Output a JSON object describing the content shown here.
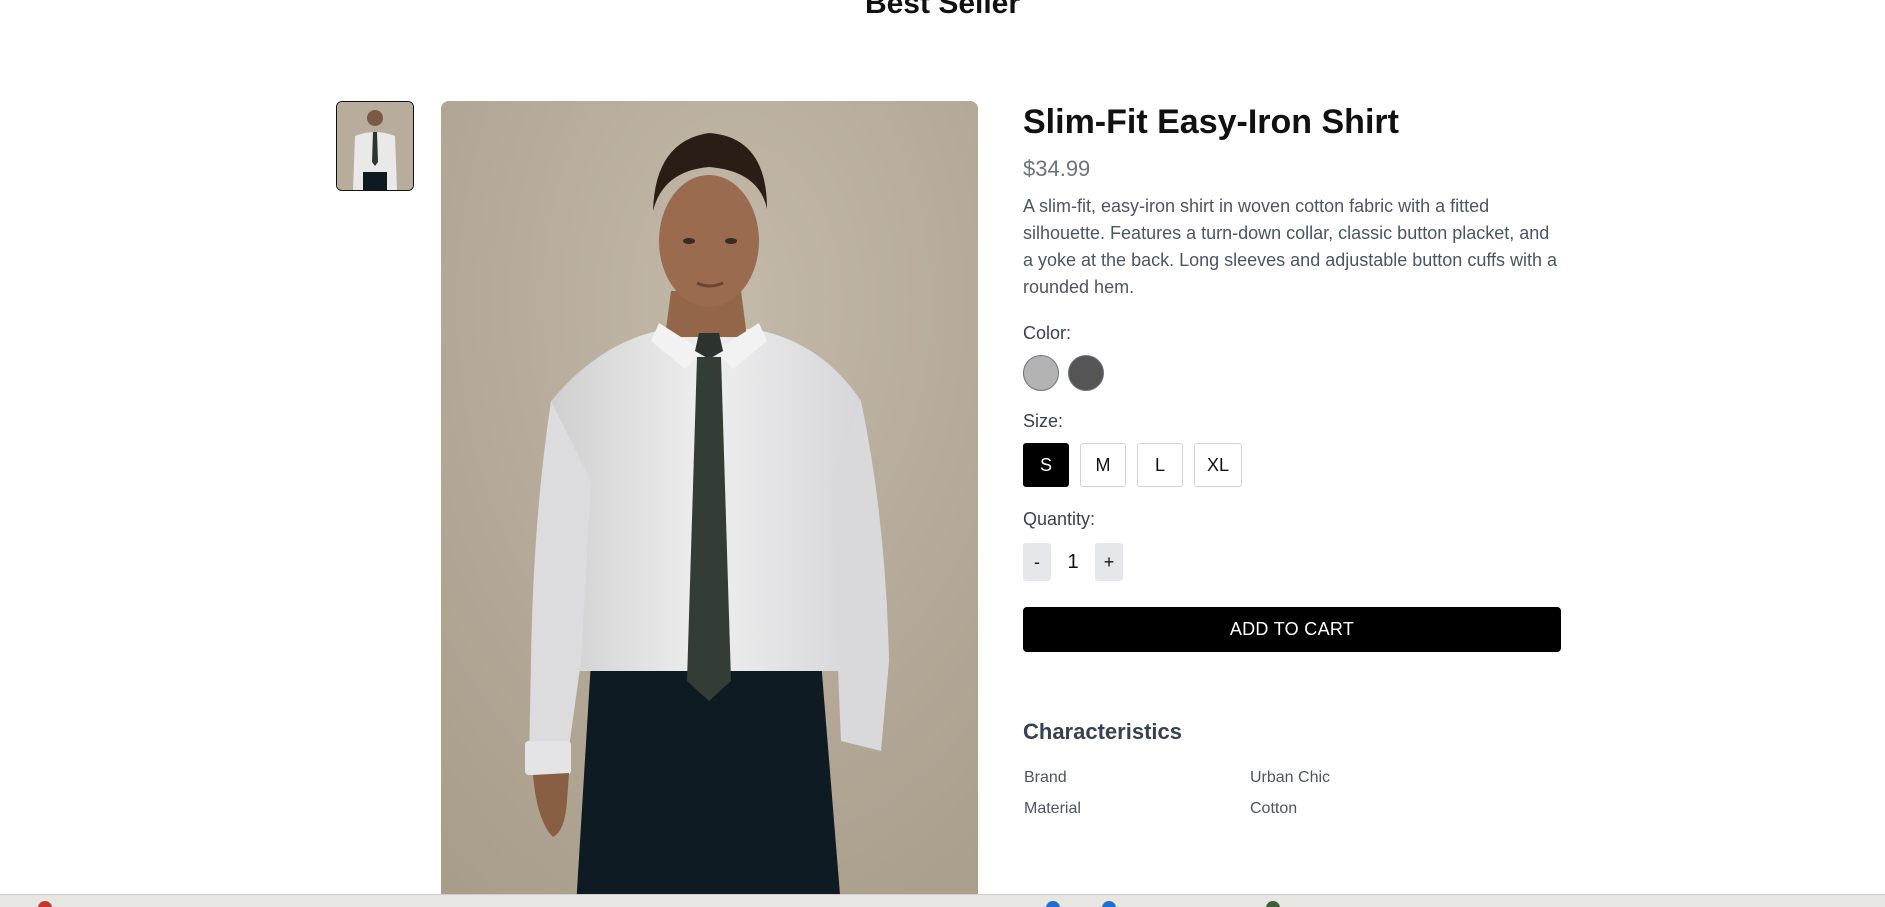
{
  "section": {
    "title": "Best Seller"
  },
  "product": {
    "title": "Slim-Fit Easy-Iron Shirt",
    "price": "$34.99",
    "description": "A slim-fit, easy-iron shirt in woven cotton fabric with a fitted silhouette. Features a turn-down collar, classic button placket, and a yoke at the back. Long sleeves and adjustable button cuffs with a rounded hem.",
    "images": {
      "main_alt": "Model wearing white shirt with dark tie",
      "thumbnail_alt": "Shirt thumbnail"
    }
  },
  "color": {
    "label": "Color:",
    "options": [
      {
        "name": "light-gray",
        "hex": "#b3b3b3"
      },
      {
        "name": "dark-gray",
        "hex": "#555555"
      }
    ]
  },
  "size": {
    "label": "Size:",
    "options": [
      "S",
      "M",
      "L",
      "XL"
    ],
    "selected": "S"
  },
  "quantity": {
    "label": "Quantity:",
    "decrement": "-",
    "value": "1",
    "increment": "+"
  },
  "actions": {
    "add_to_cart": "ADD TO CART"
  },
  "characteristics": {
    "title": "Characteristics",
    "rows": [
      {
        "key": "Brand",
        "value": "Urban Chic"
      },
      {
        "key": "Material",
        "value": "Cotton"
      }
    ]
  },
  "colors": {
    "accent": "#000000",
    "price": "#6b7280",
    "image_background": "#b5a997"
  }
}
